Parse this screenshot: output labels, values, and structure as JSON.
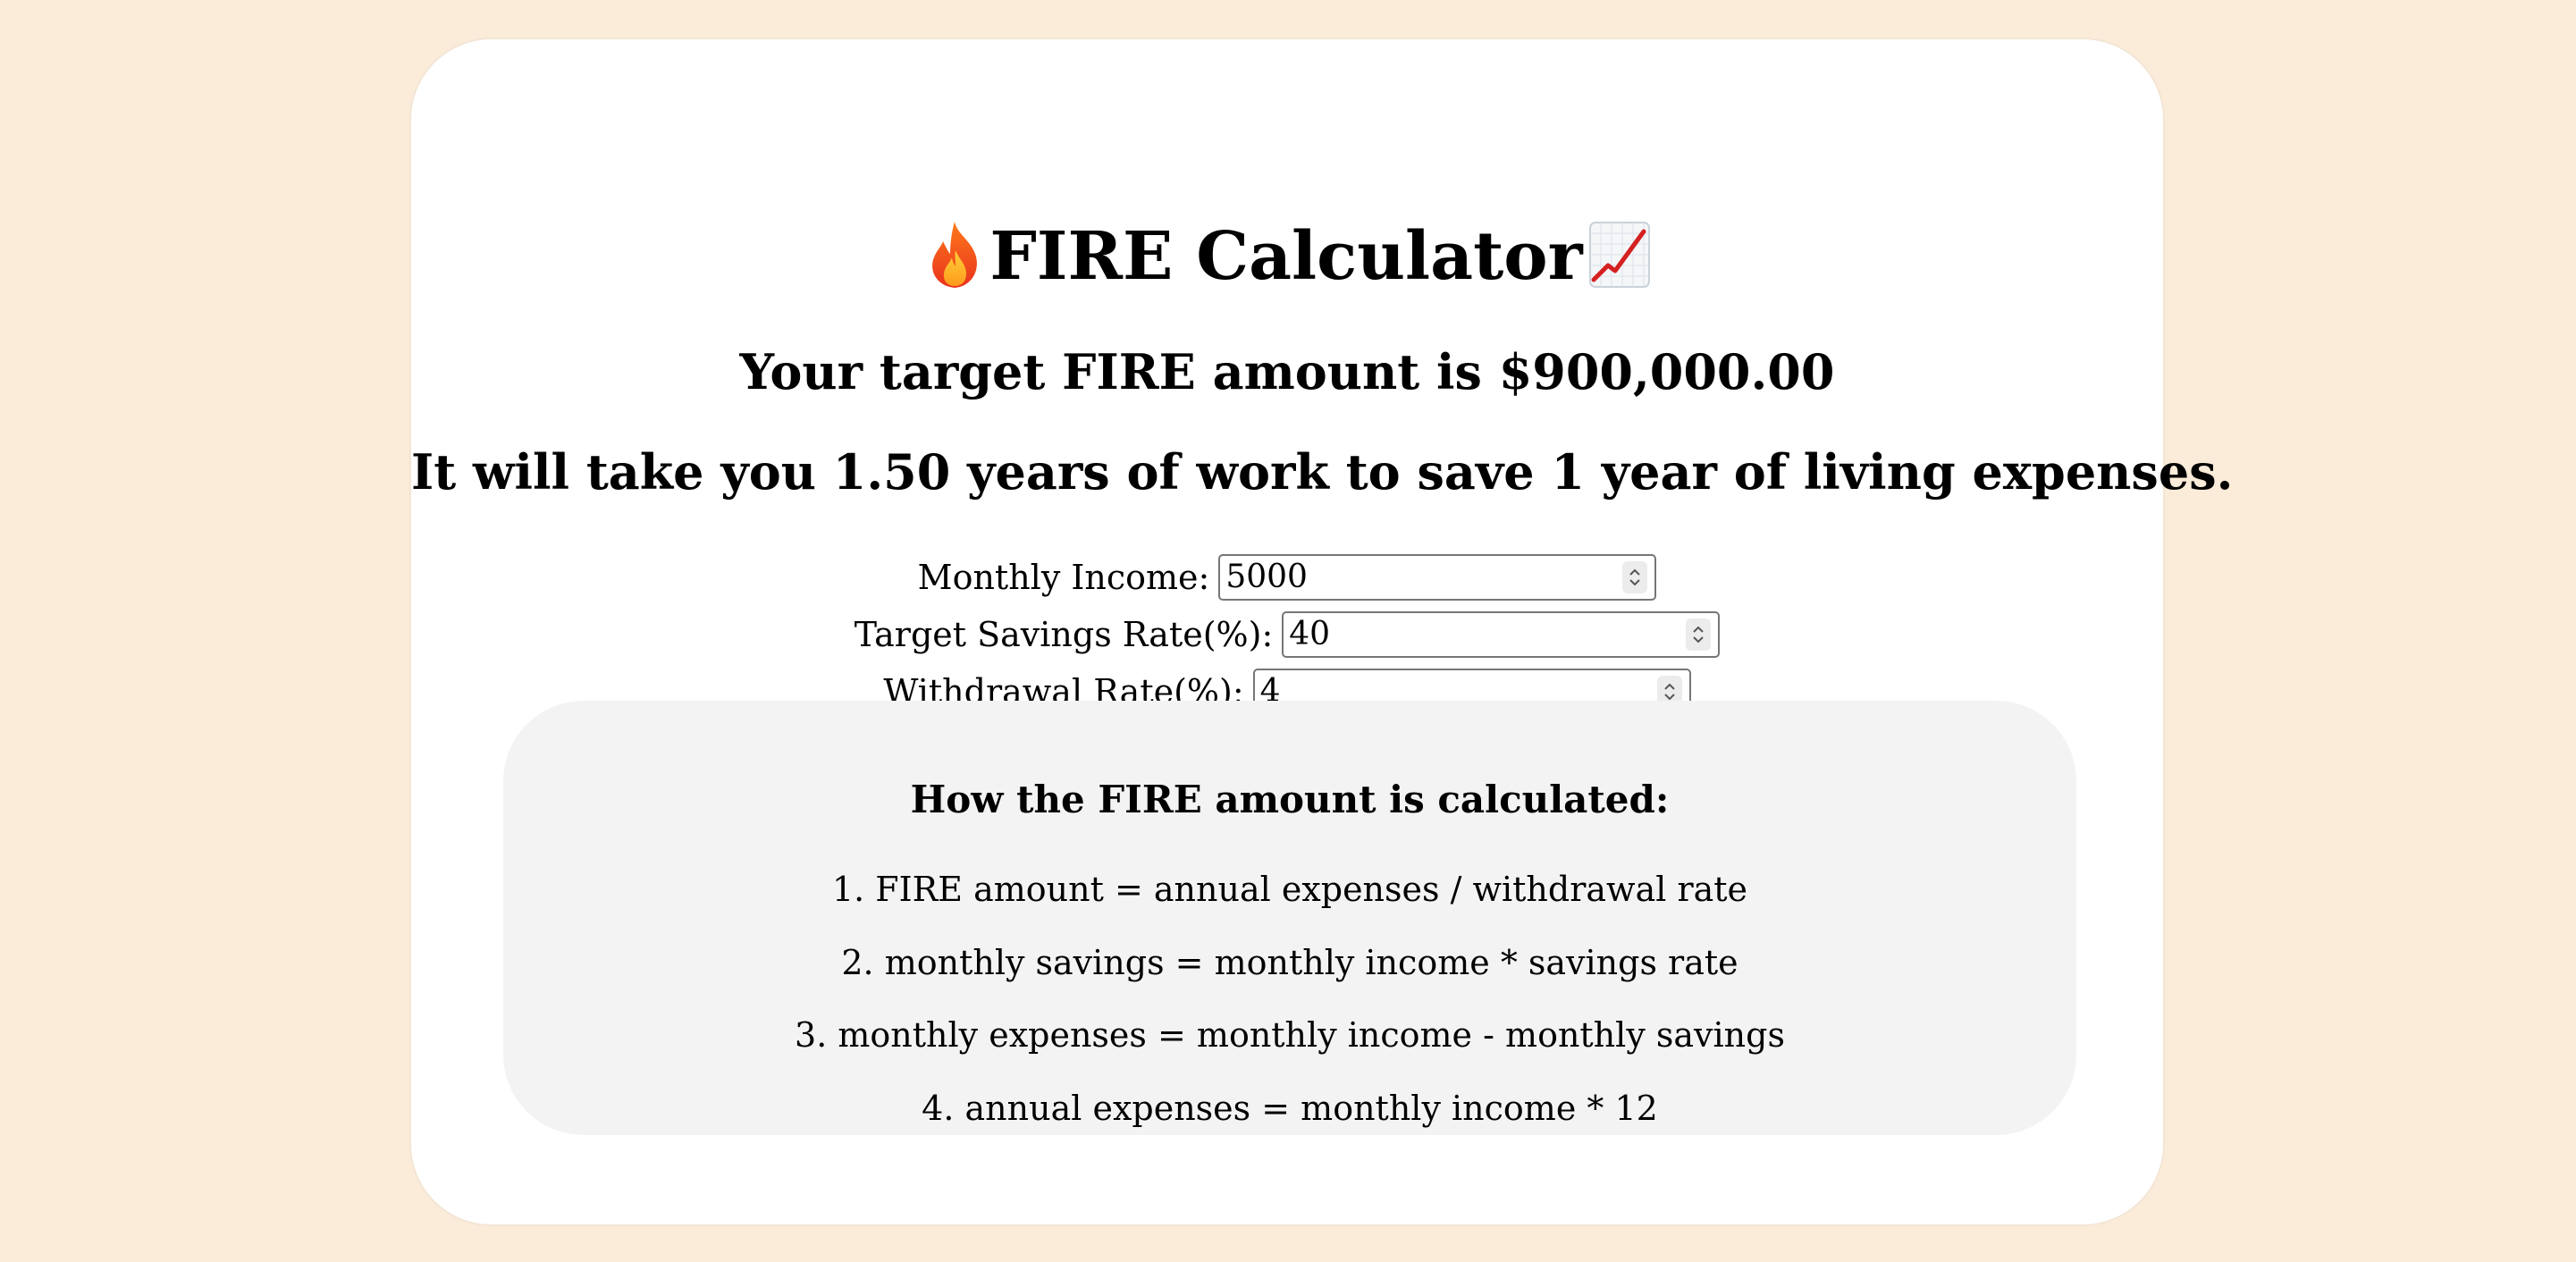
{
  "page": {
    "background_color": "#fbebd9",
    "card_color": "#ffffff",
    "explain_panel_color": "#f3f3f3"
  },
  "header": {
    "title": "FIRE Calculator",
    "leading_icon": "fire-icon",
    "trailing_icon": "chart-increasing-icon"
  },
  "results": {
    "target_text": "Your target FIRE amount is $900,000.00",
    "years_text": "It will take you 1.50 years of work to save 1 year of living expenses."
  },
  "form": {
    "monthly_income": {
      "label": "Monthly Income:",
      "value": "5000"
    },
    "savings_rate": {
      "label": "Target Savings Rate(%):",
      "value": "40"
    },
    "withdrawal_rate": {
      "label": "Withdrawal Rate(%):",
      "value": "4"
    }
  },
  "explanation": {
    "heading": "How the FIRE amount is calculated:",
    "steps": [
      "1. FIRE amount = annual expenses / withdrawal rate",
      "2. monthly savings = monthly income * savings rate",
      "3. monthly expenses = monthly income - monthly savings",
      "4. annual expenses = monthly income * 12"
    ]
  }
}
